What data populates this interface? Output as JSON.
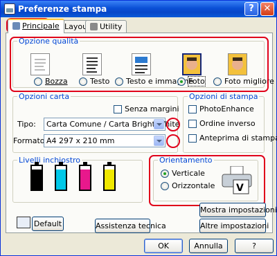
{
  "window": {
    "title": "Preferenze stampa"
  },
  "titlebar": {
    "help_glyph": "?",
    "close_glyph": "✕"
  },
  "tabs": [
    {
      "label": "Principale",
      "icon": "printer-icon",
      "selected": true
    },
    {
      "label": "Layout",
      "icon": "layout-icon"
    },
    {
      "label": "Utility",
      "icon": "utility-icon"
    }
  ],
  "quality": {
    "title": "Opzione qualità",
    "options": [
      {
        "label": "Bozza",
        "icon": "draft-doc-icon",
        "selected": false
      },
      {
        "label": "Testo",
        "icon": "text-doc-icon",
        "selected": false
      },
      {
        "label": "Testo e immagine",
        "icon": "text-image-doc-icon",
        "selected": false
      },
      {
        "label": "Foto",
        "icon": "photo-icon",
        "selected": true
      },
      {
        "label": "Foto migliore",
        "icon": "best-photo-icon",
        "selected": false
      }
    ]
  },
  "paper": {
    "title": "Opzioni carta",
    "borderless_label": "Senza margini",
    "borderless_checked": false,
    "type_label": "Tipo:",
    "type_value": "Carta Comune / Carta Bright White",
    "format_label": "Formato:",
    "format_value": "A4 297 x 210 mm"
  },
  "print_options": {
    "title": "Opzioni di stampa",
    "items": [
      {
        "label": "PhotoEnhance",
        "checked": false
      },
      {
        "label": "Ordine inverso",
        "checked": false
      },
      {
        "label": "Anteprima di stampa",
        "checked": false
      }
    ]
  },
  "ink": {
    "title": "Livelli inchiostro",
    "cartridges": [
      {
        "name": "black",
        "color": "#000000",
        "level": 0.85
      },
      {
        "name": "cyan",
        "color": "#00c8e8",
        "level": 0.85
      },
      {
        "name": "magenta",
        "color": "#e8188c",
        "level": 0.85
      },
      {
        "name": "yellow",
        "color": "#f0e800",
        "level": 0.85
      }
    ]
  },
  "orientation": {
    "title": "Orientamento",
    "options": [
      {
        "label": "Verticale",
        "selected": true
      },
      {
        "label": "Orizzontale",
        "selected": false
      }
    ]
  },
  "buttons": {
    "show_settings": "Mostra impostazioni",
    "default": "Default",
    "support": "Assistenza tecnica",
    "more_settings": "Altre impostazioni",
    "ok": "OK",
    "cancel": "Annulla",
    "help": "?"
  },
  "colors": {
    "highlight_outline": "#e0001a",
    "group_title": "#0046d5"
  }
}
